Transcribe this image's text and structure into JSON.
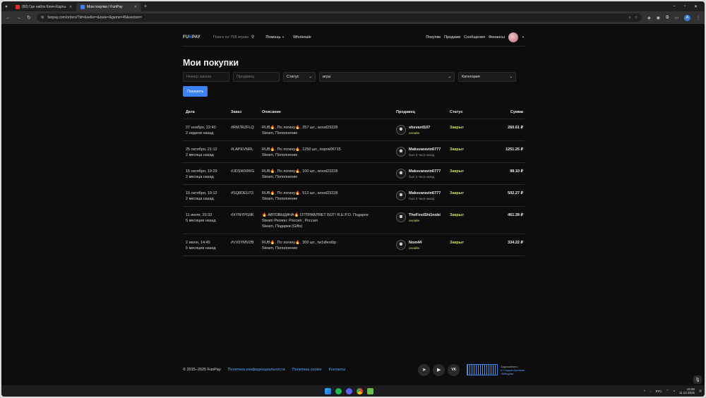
{
  "browser": {
    "tabs": [
      {
        "title": "(80) Где найти Ключ-Карты на",
        "active": false,
        "favicon_color": "#e32b2b"
      },
      {
        "title": "Мои покупки / FunPay",
        "active": true,
        "favicon_color": "#3b82f6"
      }
    ],
    "url": "funpay.com/orders/?id=&seller=&state=&game=45&section="
  },
  "site": {
    "logo_a": "FU",
    "logo_b": "N",
    "logo_c": "PAY",
    "search_placeholder": "Поиск по 758 играм",
    "nav_help": "Помощь",
    "nav_wholesale": "Wholesale",
    "nav_purchases": "Покупки",
    "nav_sales": "Продажи",
    "nav_messages": "Сообщения",
    "nav_finance": "Финансы"
  },
  "page": {
    "title": "Мои покупки",
    "filters": {
      "order_placeholder": "Номер заказа",
      "seller_placeholder": "Продавец",
      "status_label": "Статус",
      "game_label": "игра",
      "category_label": "Категория",
      "show_button": "Показать"
    },
    "columns": [
      "Дата",
      "Заказ",
      "Описание",
      "Продавец",
      "Статус",
      "Сумма"
    ],
    "orders": [
      {
        "date": "27 ноября, 22:40",
        "ago": "2 недели назад",
        "id": "#RM7RZFLQ",
        "desc1_a": "RUB",
        "desc1_b": ", По логину",
        "desc1_c": ", 257 шт., wood23228",
        "desc2": "Steam, Пополнение",
        "seller": "shevard107",
        "seller_status": "онлайн",
        "seller_online": true,
        "status": "Закрыт",
        "sum": "260.61 ₽"
      },
      {
        "date": "25 октября, 21:12",
        "ago": "2 месяца назад",
        "id": "#LAPEVNRL",
        "desc1_a": "RUB",
        "desc1_b": ", По логину",
        "desc1_c": ", 1250 шт., toqnw06715",
        "desc2": "Steam, Пополнение",
        "seller": "Maksvaravin6777",
        "seller_status": "был 3 часа назад",
        "seller_online": false,
        "status": "Закрыт",
        "sum": "1251.25 ₽"
      },
      {
        "date": "15 октября, 19:29",
        "ago": "2 месяца назад",
        "id": "#JDSWX8KG",
        "desc1_a": "RUB",
        "desc1_b": ", По логину",
        "desc1_c": ", 100 шт., wood23228",
        "desc2": "Steam, Пополнение",
        "seller": "Maksvaravin6777",
        "seller_status": "был 3 часа назад",
        "seller_online": false,
        "status": "Закрыт",
        "sum": "98.10 ₽"
      },
      {
        "date": "15 октября, 19:12",
        "ago": "2 месяца назад",
        "id": "#SQ8DEU73",
        "desc1_a": "RUB",
        "desc1_b": ", По логину",
        "desc1_c": ", 512 шт., wood23228",
        "desc2": "Steam, Пополнение",
        "seller": "Maksvaravin6777",
        "seller_status": "был 3 часа назад",
        "seller_online": false,
        "status": "Закрыт",
        "sum": "502.27 ₽"
      },
      {
        "date": "11 июля, 20:33",
        "ago": "5 месяцев назад",
        "id": "#XYNYPG9K",
        "desc1_a": "",
        "desc1_b": " АВТОВЫДАЧА",
        "desc1_c": " ОТПРАВЛЯЕТ БОТ! R.E.P.O. Подарок",
        "desc2": "Steam Регион: Россия , Россия",
        "desc3": "Steam, Подарки (Gifts)",
        "seller": "TheFirstShi1nobi",
        "seller_status": "онлайн",
        "seller_online": true,
        "status": "Закрыт",
        "sum": "461.39 ₽"
      },
      {
        "date": "2 июля, 14:45",
        "ago": "5 месяцев назад",
        "id": "#VX5YMVZB",
        "desc1_a": "RUB",
        "desc1_b": ", По логину",
        "desc1_c": ", 300 шт., tw1dlest0p",
        "desc2": "Steam, Пополнение",
        "seller": "Nom44",
        "seller_status": "онлайн",
        "seller_online": true,
        "status": "Закрыт",
        "sum": "334.22 ₽"
      }
    ]
  },
  "footer": {
    "copyright": "© 2015–2025 FunPay",
    "privacy": "Политика конфиденциальности",
    "cookie": "Политика cookie",
    "contacts": "Контакты",
    "made_1": "Задизайнено",
    "made_2": "в Студии Артемия",
    "made_3": "Лебедева"
  },
  "taskbar": {
    "lang": "РУС",
    "time": "15:56",
    "date": "11.12.2025"
  },
  "colors": {
    "accent": "#3b82f6",
    "status_closed": "#cde75f",
    "link": "#58a6ff"
  }
}
